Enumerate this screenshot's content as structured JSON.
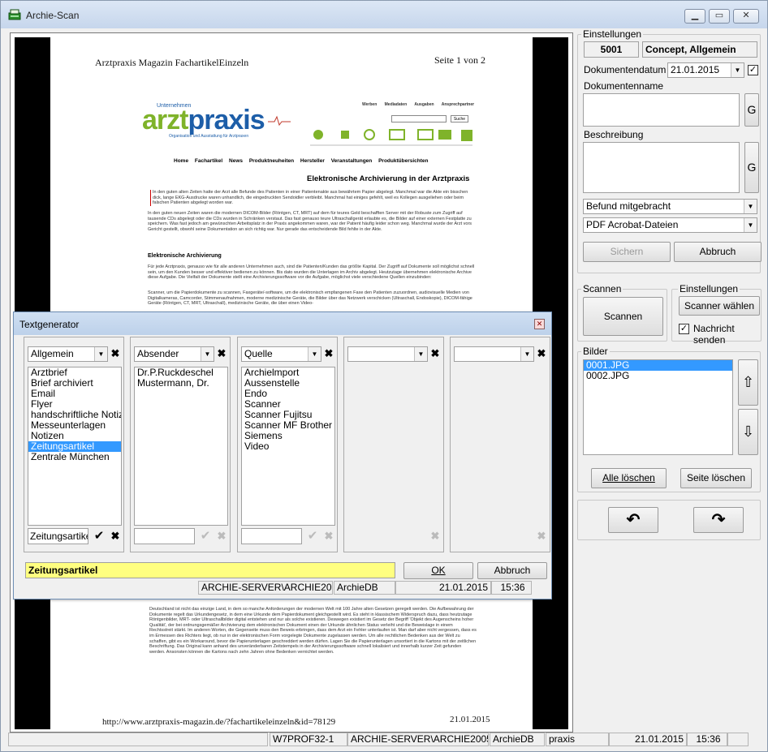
{
  "window": {
    "title": "Archie-Scan",
    "min": "▁",
    "max": "▭",
    "close": "✕"
  },
  "document": {
    "header_left": "Arztpraxis Magazin FachartikelEinzeln",
    "header_right": "Seite 1 von 2",
    "logo_small": "Unternehmen",
    "logo_text": "arztpraxis",
    "logo_tagline": "Organisation und Ausstattung für Arztpraxen",
    "toplinks": [
      "Werben",
      "Mediadaten",
      "Ausgaben",
      "Ansprechpartner"
    ],
    "search_button": "Suche",
    "nav": [
      "Home",
      "Fachartikel",
      "News",
      "Produktneuheiten",
      "Hersteller",
      "Veranstaltungen",
      "Produktübersichten"
    ],
    "article_title": "Elektronische Archivierung in der Arztpraxis",
    "p1": "In den guten alten Zeiten hatte der Arzt alle Befunde des Patienten in einer Patientenakte aus bewährtem Papier abgelegt. Manchmal war die Akte ein bisschen dick, lange EKG-Ausdrucke waren unhandlich, die eingedruckten Sendoidler verbleibt. Manchmal hat einiges gefehlt, weil es Kollegen ausgeliehen oder beim falschen Patienten abgelegt worden war.",
    "p2": "In den guten neuen Zeiten waren die modernen DICOM-Bilder (Röntgen, CT, MRT) auf dem für teures Geld beschafften Server mit der Robuste zum Zugriff auf tausende CDs abgelegt oder die CDs wurden in Schränken verstaut. Das fast genauso teure Ultraschallgerät erlaubte es, die Bilder auf einer externen Festplatte zu speichern. Was fast jedoch am gewünschten Arbeitsplatz in der Praxis angekommen waren, war der Patient häufig leider schon weg. Manchmal wurde der Arzt vors Gericht gestellt, obwohl seine Dokumentation an sich richtig war. Nur gerade das entscheidende Bild fehlte in der Akte.",
    "h2": "Elektronische Archivierung",
    "p3": "Für jede Arztpraxis, genauso wie für alle anderen Unternehmen auch, sind die Patienten/Kunden das größte Kapital. Der Zugriff auf Dokumente soll möglichst schnell sein, um den Kunden besser und effektiver bedienen zu können. Bis dato wurden die Unterlagen im Archiv abgelegt. Heutzutage übernehmen elektronische Archive diese Aufgabe. Die Vielfalt der Dokumente stellt eine Archivierungssoftware vor die Aufgabe, möglichst viele verschiedene Quellen einzubinden:",
    "p4": "Scanner, um die Papierdokumente zu scannen, Faxgeräte/-software, um die elektronisch empfangenen Faxe den Patienten zuzuordnen, audiovisuelle Medien von Digitalkameras, Camcorder, Stimmenaufnahmen, moderne medizinische Geräte, die Bilder über das Netzwerk verschicken (Ultraschall, Endoskopie), DICOM-fähige Geräte (Röntgen, CT, MRT, Ultraschall), medizinische Geräte, die über einen Video-",
    "p5": "Deutschland ist nicht das einzige Land, in dem so manche Anforderungen der modernen Welt mit 100 Jahre alten Gesetzen geregelt werden. Die Aufbewahrung der Dokumente regelt das Urkundengesetz, in dem eine Urkunde dem Papierdokument gleichgestellt wird. Es steht in klassischem Widerspruch dazu, dass heutzutage Röntgenbilder, MRT- oder Ultraschallbilder digital entstehen und nur als solche existieren. Deswegen existiert im Gesetz der Begriff 'Objekt des Augenscheins hoher Qualität', der bei ordnungsgemäßer Archivierung dem elektronischen Dokument einen der Urkunde ähnlichen Status verleiht und die Beweislage in einem Rechtsstreit stärkt. Im anderen Worten, die Gegenseite muss den Beweis erbringen, dass dem Arzt ein Fehler unterlaufen ist. Man darf aber nicht vergessen, dass es im Ermessen des Richters liegt, ob nur in der elektronischen Form vorgelegte Dokumente zugelassen werden. Um alle rechtlichen Bedenken aus der Welt zu schaffen, gibt es ein Workaround, bevor die Papierunterlagen geschreddert werden dürfen. Lagen Sie die Papierunterlagen unsortiert in die Kartons mit der zeitlichen Beschriftung. Das Original kann anhand des unveränderbaren Zeitstempels in der Archivierungssoftware schnell lokalisiert und innerhalb kurzer Zeit gefunden werden. Ansonsten können die Kartons nach zehn Jahren ohne Bedenken vernichtet werden.",
    "footer_url": "http://www.arztpraxis-magazin.de/?fachartikeleinzeln&id=78129",
    "footer_date": "21.01.2015"
  },
  "settings": {
    "group_label": "Einstellungen",
    "id": "5001",
    "name": "Concept, Allgemein",
    "date_label": "Dokumentendatum",
    "date_value": "21.01.2015",
    "date_checked": true,
    "docname_label": "Dokumentenname",
    "docname_value": "",
    "g_button": "G",
    "desc_label": "Beschreibung",
    "desc_value": "",
    "combo1": "Befund mitgebracht",
    "combo2": "PDF Acrobat-Dateien",
    "save": "Sichern",
    "cancel": "Abbruch"
  },
  "scan": {
    "group_label": "Scannen",
    "button": "Scannen",
    "settings_label": "Einstellungen",
    "choose": "Scanner wählen",
    "notify_label": "Nachricht senden",
    "notify_checked": true
  },
  "images": {
    "group_label": "Bilder",
    "items": [
      "0001.JPG",
      "0002.JPG"
    ],
    "selected": 0,
    "up": "⇧",
    "down": "⇩",
    "delete_all": "Alle löschen",
    "delete_page": "Seite löschen",
    "rotate_left": "↶",
    "rotate_right": "↷"
  },
  "textgen": {
    "title": "Textgenerator",
    "close": "✕",
    "col1": {
      "combo": "Allgemein",
      "items": [
        "Arztbrief",
        "Brief archiviert",
        "Email",
        "Flyer",
        "handschriftliche Notiz",
        "Messeunterlagen",
        "Notizen",
        "Zeitungsartikel",
        "Zentrale München"
      ],
      "selected": 7,
      "input": "Zeitungsartikel"
    },
    "col2": {
      "combo": "Absender",
      "items": [
        "Dr.P.Ruckdeschel",
        "Mustermann, Dr."
      ],
      "input": ""
    },
    "col3": {
      "combo": "Quelle",
      "items": [
        "Archielmport",
        "Aussenstelle",
        "Endo",
        "Scanner",
        "Scanner Fujitsu",
        "Scanner MF Brother",
        "Siemens",
        "Video"
      ],
      "input": ""
    },
    "col4": {
      "combo": ""
    },
    "col5": {
      "combo": ""
    },
    "result": "Zeitungsartikel",
    "ok": "OK",
    "cancel": "Abbruch",
    "status": [
      "ARCHIE-SERVER\\ARCHIE2005",
      "ArchieDB",
      "21.01.2015",
      "15:36"
    ]
  },
  "statusbar": [
    "W7PROF32-1",
    "ARCHIE-SERVER\\ARCHIE2005",
    "ArchieDB",
    "praxis",
    "21.01.2015",
    "15:36"
  ],
  "colors": {
    "accent": "#3399ff",
    "result_bg": "#ffff80",
    "logo_green": "#7fb32a",
    "logo_blue": "#1d5ea8"
  }
}
